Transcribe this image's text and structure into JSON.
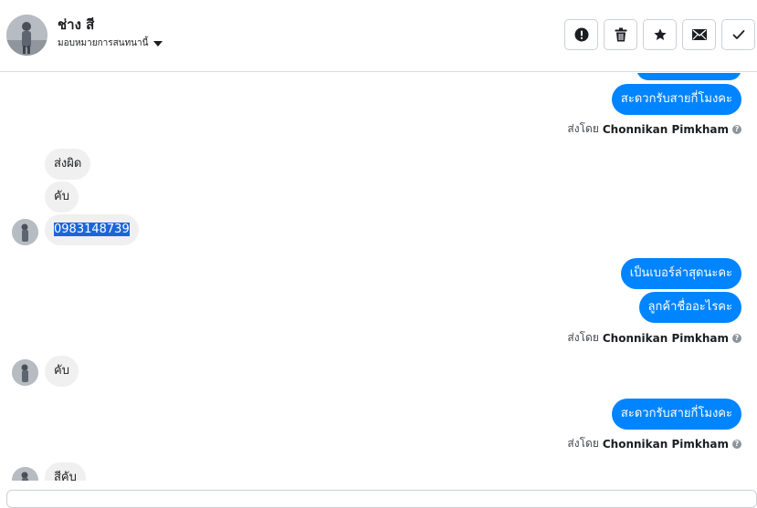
{
  "contact": {
    "name": "ช่าง สี",
    "assign_label": "มอบหมายการสนทนานี้"
  },
  "actions": [
    {
      "name": "mark-spam-button",
      "icon": "alert-icon"
    },
    {
      "name": "delete-button",
      "icon": "trash-icon"
    },
    {
      "name": "star-button",
      "icon": "star-icon"
    },
    {
      "name": "mark-unread-button",
      "icon": "envelope-icon"
    },
    {
      "name": "done-button",
      "icon": "check-icon"
    }
  ],
  "messages": {
    "out_1": "สะดวกรับสายกี่โมงคะ",
    "sent_1_prefix": "ส่งโดย",
    "sent_1_name": "Chonnikan Pimkham",
    "in_1": "ส่งผิด",
    "in_2": "คับ",
    "in_3": "0983148739",
    "out_2": "เป็นเบอร์ล่าสุดนะคะ",
    "out_3": "ลูกค้าชื่ออะไรคะ",
    "sent_2_prefix": "ส่งโดย",
    "sent_2_name": "Chonnikan Pimkham",
    "in_4": "คับ",
    "out_4": "สะดวกรับสายกี่โมงคะ",
    "sent_3_prefix": "ส่งโดย",
    "sent_3_name": "Chonnikan Pimkham",
    "in_5": "สีคับ"
  },
  "colors": {
    "outgoing": "#0084ff",
    "incoming": "#f0f0f0",
    "selection": "#1a66d9"
  }
}
